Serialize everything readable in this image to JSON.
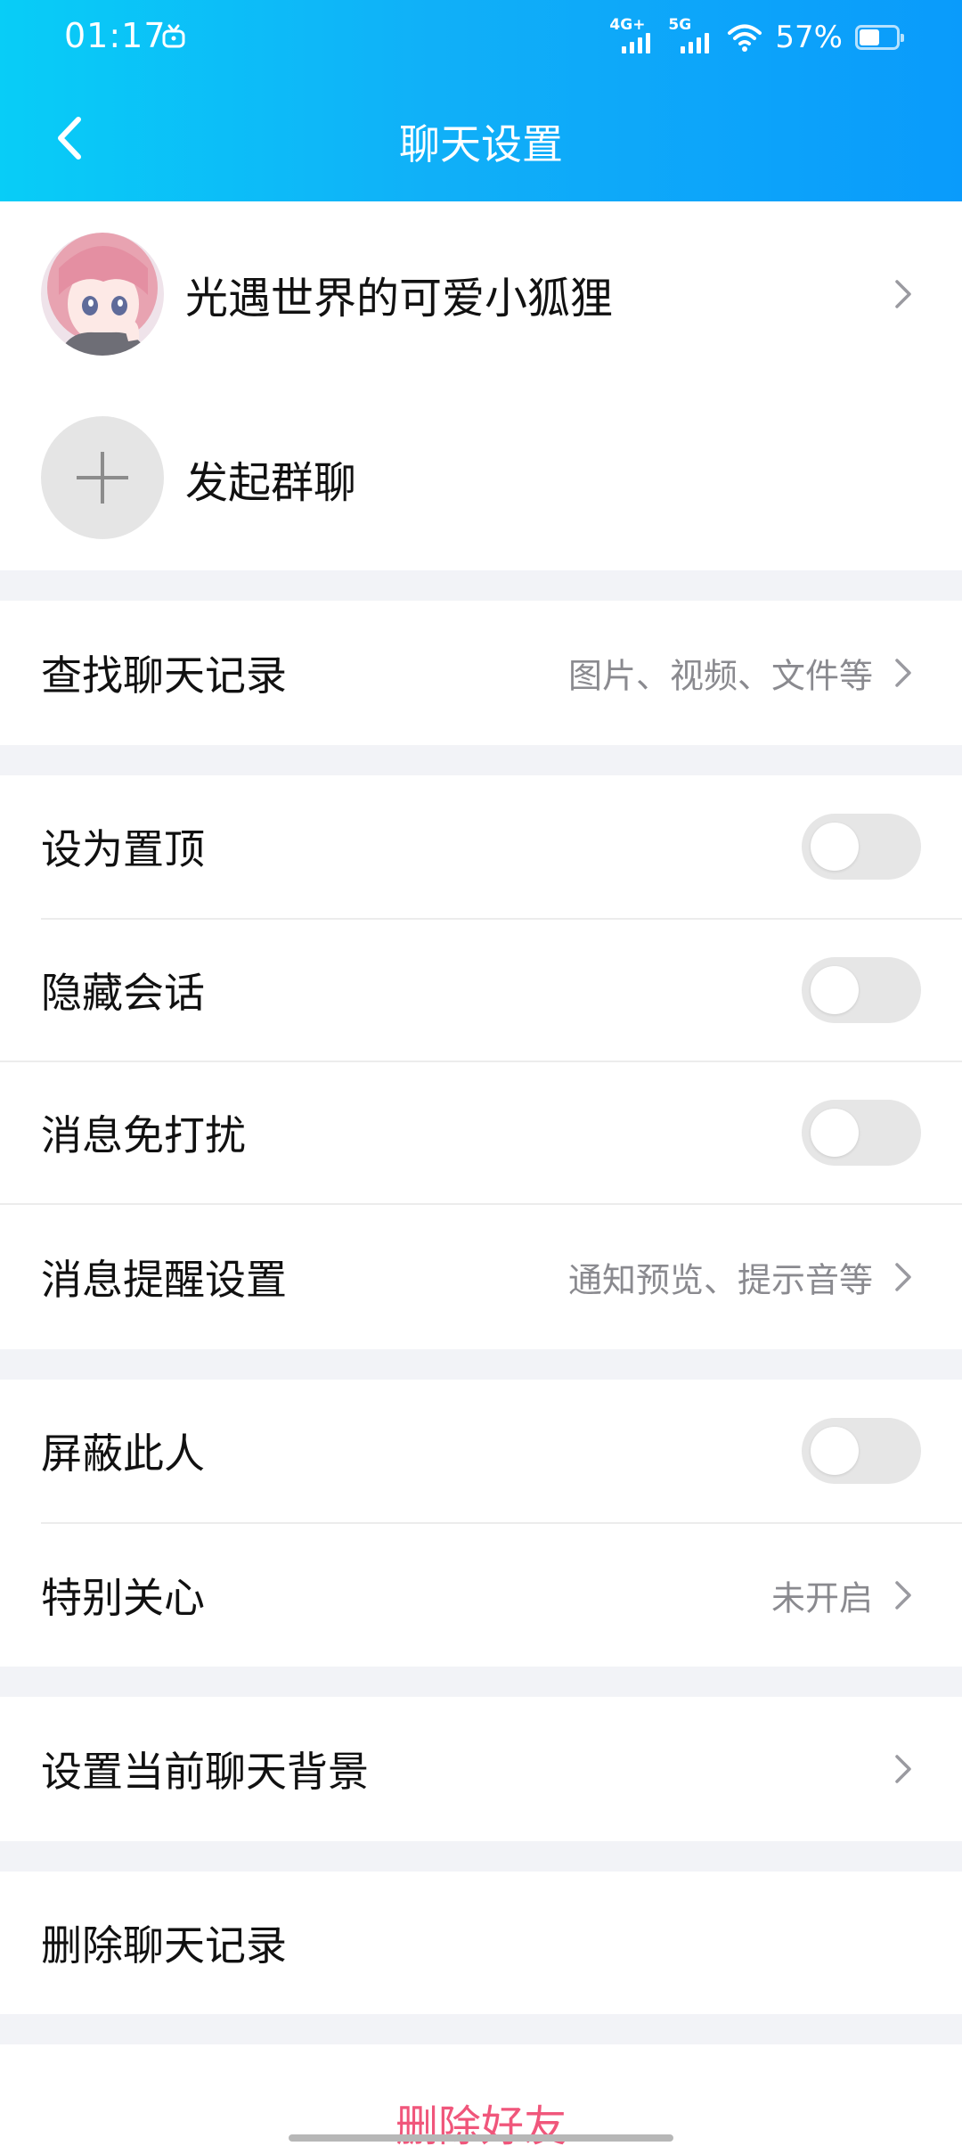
{
  "status": {
    "time": "01:17",
    "net1": "4G+",
    "net2": "5G",
    "battery": "57%",
    "battery_level": 0.57
  },
  "header": {
    "title": "聊天设置"
  },
  "profile": {
    "name": "光遇世界的可爱小狐狸"
  },
  "group": {
    "label": "发起群聊"
  },
  "search": {
    "label": "查找聊天记录",
    "sub": "图片、视频、文件等"
  },
  "toggles": {
    "pin": {
      "label": "设为置顶",
      "on": false
    },
    "hide": {
      "label": "隐藏会话",
      "on": false
    },
    "mute": {
      "label": "消息免打扰",
      "on": false
    }
  },
  "notify": {
    "label": "消息提醒设置",
    "sub": "通知预览、提示音等"
  },
  "block": {
    "label": "屏蔽此人",
    "on": false
  },
  "care": {
    "label": "特别关心",
    "sub": "未开启"
  },
  "background": {
    "label": "设置当前聊天背景"
  },
  "clear": {
    "label": "删除聊天记录"
  },
  "delete": {
    "label": "删除好友"
  },
  "colors": {
    "accent": "#0a9bfb",
    "danger": "#f0567b"
  }
}
